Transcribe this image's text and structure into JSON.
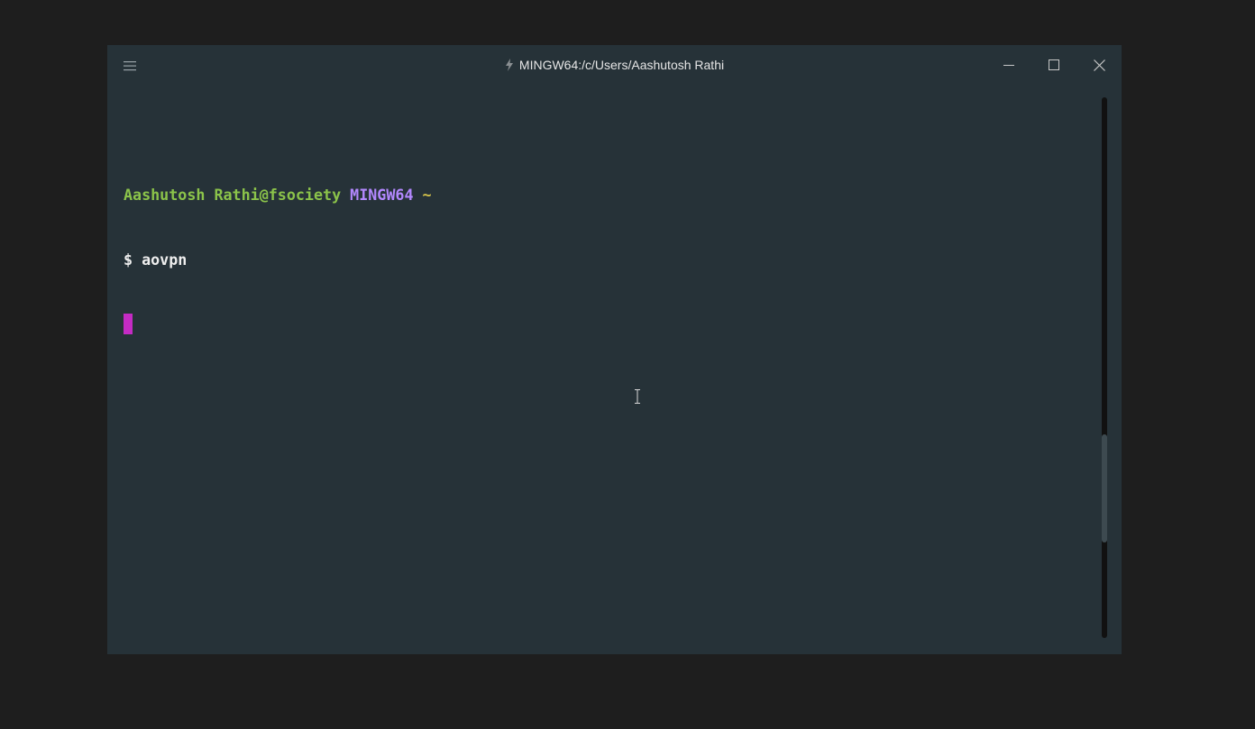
{
  "window": {
    "title": "MINGW64:/c/Users/Aashutosh Rathi",
    "title_icon": "lightning-bolt-icon",
    "menu_icon": "hamburger-menu-icon",
    "controls": {
      "minimize_icon": "minimize-icon",
      "maximize_icon": "maximize-icon",
      "close_icon": "close-icon"
    }
  },
  "terminal": {
    "prompt": {
      "user_host": "Aashutosh Rathi@fsociety",
      "system": "MINGW64",
      "path": "~"
    },
    "command_line": {
      "symbol": "$",
      "command": "aovpn"
    },
    "cursor_color": "#c42bc4"
  },
  "scrollbar": {
    "position": 0.78,
    "visible_fraction": 0.2
  },
  "colors": {
    "background": "#263238",
    "user": "#8bc34a",
    "host": "#b388ff",
    "path": "#d4c24a",
    "text": "#eeeeee"
  }
}
